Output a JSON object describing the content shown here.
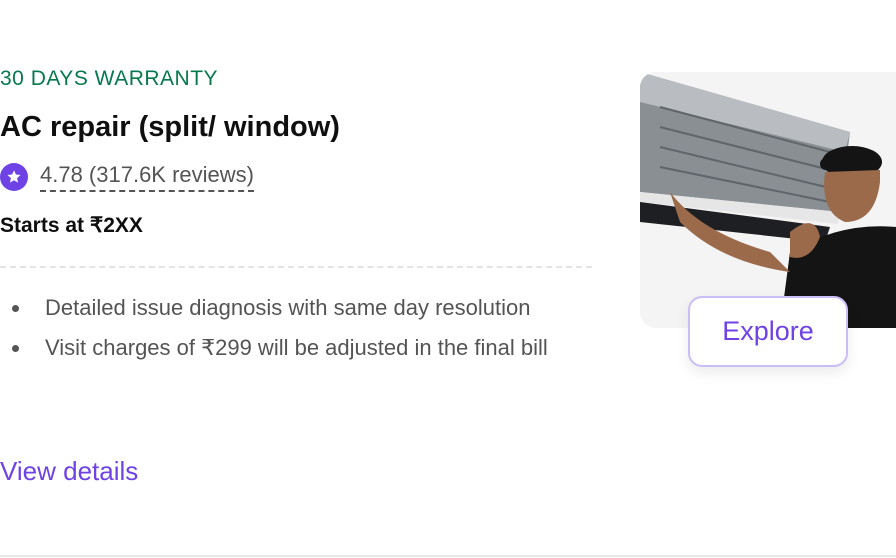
{
  "service": {
    "warranty_badge": "30 DAYS WARRANTY",
    "title": "AC repair (split/ window)",
    "rating": "4.78 (317.6K reviews)",
    "price": "Starts at ₹2XX",
    "bullets": [
      "Detailed issue diagnosis with same day resolution",
      "Visit charges of ₹299 will be adjusted in the final bill"
    ],
    "view_details_label": "View details",
    "explore_label": "Explore",
    "star_icon": "star-icon",
    "colors": {
      "accent": "#6e42e5",
      "warranty": "#07794c",
      "text": "#0f0f0f",
      "muted": "#545454"
    }
  }
}
